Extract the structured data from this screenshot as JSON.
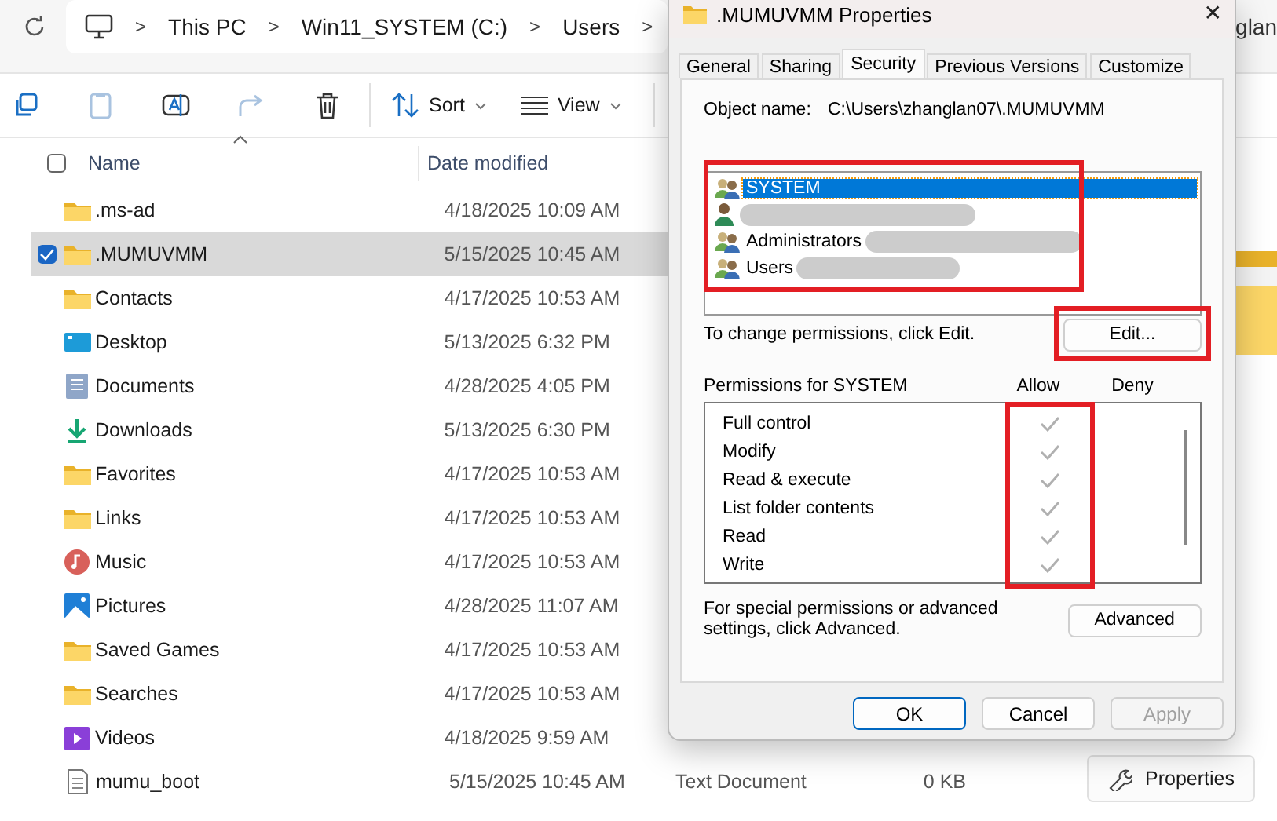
{
  "explorer": {
    "breadcrumb": [
      {
        "kind": "computer"
      },
      {
        "kind": "sep",
        "text": ">"
      },
      {
        "kind": "crumb",
        "text": "This PC"
      },
      {
        "kind": "sep",
        "text": ">"
      },
      {
        "kind": "crumb",
        "text": "Win11_SYSTEM (C:)"
      },
      {
        "kind": "sep",
        "text": ">"
      },
      {
        "kind": "crumb",
        "text": "Users"
      },
      {
        "kind": "sep",
        "text": ">"
      }
    ],
    "breadcrumb_tail": "glan",
    "toolbar": [
      {
        "kind": "copy"
      },
      {
        "kind": "paste"
      },
      {
        "kind": "rename"
      },
      {
        "kind": "share"
      },
      {
        "kind": "delete"
      },
      {
        "kind": "divider"
      },
      {
        "kind": "sort",
        "label": "Sort"
      },
      {
        "kind": "view",
        "label": "View"
      },
      {
        "kind": "divider"
      }
    ],
    "select_all_checked": false,
    "columns": [
      "Name",
      "Date modified"
    ],
    "rows": [
      {
        "kind": "folder",
        "name": ".ms-ad",
        "date": "4/18/2025 10:09 AM",
        "selected": false
      },
      {
        "kind": "folder",
        "name": ".MUMUVMM",
        "date": "5/15/2025 10:45 AM",
        "selected": true
      },
      {
        "kind": "folder",
        "name": "Contacts",
        "date": "4/17/2025 10:53 AM",
        "selected": false
      },
      {
        "kind": "desktop",
        "name": "Desktop",
        "date": "5/13/2025 6:32 PM",
        "selected": false
      },
      {
        "kind": "documents",
        "name": "Documents",
        "date": "4/28/2025 4:05 PM",
        "selected": false
      },
      {
        "kind": "downloads",
        "name": "Downloads",
        "date": "5/13/2025 6:30 PM",
        "selected": false
      },
      {
        "kind": "folder",
        "name": "Favorites",
        "date": "4/17/2025 10:53 AM",
        "selected": false
      },
      {
        "kind": "folder",
        "name": "Links",
        "date": "4/17/2025 10:53 AM",
        "selected": false
      },
      {
        "kind": "music",
        "name": "Music",
        "date": "4/17/2025 10:53 AM",
        "selected": false
      },
      {
        "kind": "pictures",
        "name": "Pictures",
        "date": "4/28/2025 11:07 AM",
        "selected": false
      },
      {
        "kind": "folder",
        "name": "Saved Games",
        "date": "4/17/2025 10:53 AM",
        "selected": false
      },
      {
        "kind": "folder",
        "name": "Searches",
        "date": "4/17/2025 10:53 AM",
        "selected": false
      },
      {
        "kind": "videos",
        "name": "Videos",
        "date": "4/18/2025 9:59 AM",
        "selected": false
      },
      {
        "kind": "file",
        "name": "mumu_boot",
        "date": "5/15/2025 10:45 AM",
        "selected": false,
        "type": "Text Document",
        "size": "0 KB"
      }
    ],
    "properties_button": "Properties"
  },
  "dialog": {
    "title": ".MUMUVMM Properties",
    "close": "✕",
    "tabs": [
      {
        "label": "General",
        "selected": false
      },
      {
        "label": "Sharing",
        "selected": false
      },
      {
        "label": "Security",
        "selected": true
      },
      {
        "label": "Previous Versions",
        "selected": false
      },
      {
        "label": "Customize",
        "selected": false
      }
    ],
    "object_label": "Object name:",
    "object_value": "C:\\Users\\zhanglan07\\.MUMUVMM",
    "users": [
      {
        "kind": "group",
        "name": "SYSTEM",
        "selected": true,
        "redacted": false
      },
      {
        "kind": "user",
        "selected": false,
        "redacted": true
      },
      {
        "kind": "group",
        "name": "Administrators",
        "selected": false,
        "redacted": true
      },
      {
        "kind": "group",
        "name": "Users",
        "selected": false,
        "redacted": true
      }
    ],
    "change_hint": "To change permissions, click Edit.",
    "edit_button": "Edit...",
    "permissions_label": "Permissions for SYSTEM",
    "allow_label": "Allow",
    "deny_label": "Deny",
    "permissions": [
      {
        "name": "Full control",
        "allow": true,
        "deny": false
      },
      {
        "name": "Modify",
        "allow": true,
        "deny": false
      },
      {
        "name": "Read & execute",
        "allow": true,
        "deny": false
      },
      {
        "name": "List folder contents",
        "allow": true,
        "deny": false
      },
      {
        "name": "Read",
        "allow": true,
        "deny": false
      },
      {
        "name": "Write",
        "allow": true,
        "deny": false
      }
    ],
    "advanced_hint": "For special permissions or advanced settings, click Advanced.",
    "advanced_button": "Advanced",
    "buttons": [
      {
        "label": "OK",
        "kind": "default"
      },
      {
        "label": "Cancel",
        "kind": "normal"
      },
      {
        "label": "Apply",
        "kind": "disabled"
      }
    ]
  },
  "annotations": [
    {
      "kind": "box"
    },
    {
      "kind": "box"
    },
    {
      "kind": "box"
    }
  ]
}
